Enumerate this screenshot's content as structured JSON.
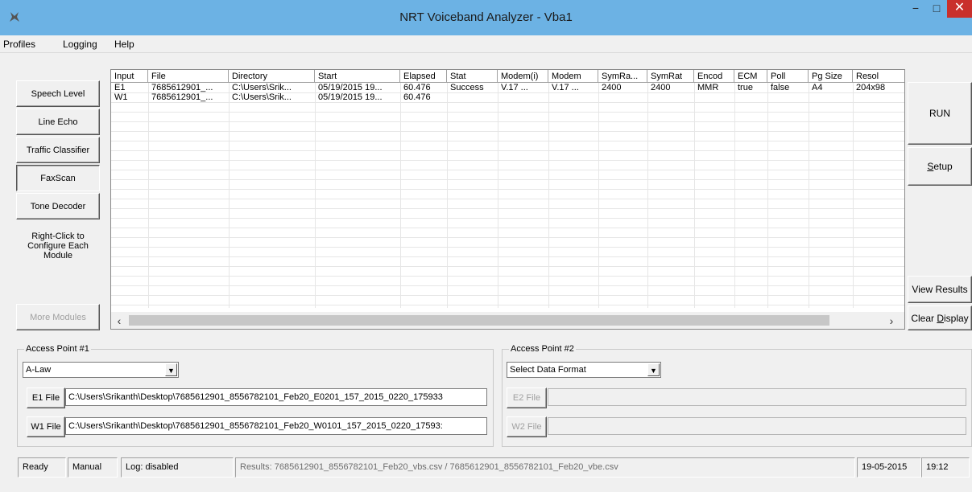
{
  "window": {
    "title": "NRT Voiceband Analyzer - Vba1",
    "minimize": "−",
    "maximize": "□",
    "close": "✕",
    "app_icon": "vba-app-icon"
  },
  "menu": [
    "Profiles",
    "Logging",
    "Help"
  ],
  "modules": [
    "Speech Level",
    "Line Echo",
    "Traffic Classifier",
    "FaxScan",
    "Tone Decoder"
  ],
  "module_note": [
    "Right-Click to",
    "Configure Each",
    "Module"
  ],
  "more_modules": "More Modules",
  "table": {
    "columns": [
      "Input",
      "File",
      "Directory",
      "Start",
      "Elapsed",
      "Stat",
      "Modem(i)",
      "Modem",
      "SymRa...",
      "SymRat",
      "Encod",
      "ECM",
      "Poll",
      "Pg Size",
      "Resol"
    ],
    "rows": [
      [
        "E1",
        "7685612901_...",
        "C:\\Users\\Srik...",
        "05/19/2015 19...",
        "60.476",
        "Success",
        "V.17 ...",
        "V.17 ...",
        "2400",
        "2400",
        "MMR",
        "true",
        "false",
        "A4",
        "204x98"
      ],
      [
        "W1",
        "7685612901_...",
        "C:\\Users\\Srik...",
        "05/19/2015 19...",
        "60.476",
        "",
        "",
        "",
        "",
        "",
        "",
        "",
        "",
        "",
        ""
      ]
    ]
  },
  "right_buttons": {
    "run": "RUN",
    "setup_prefix": "",
    "setup_mnemonic": "S",
    "setup_rest": "etup",
    "view_results": "View Results",
    "clear_prefix": "Clear ",
    "clear_mnemonic": "D",
    "clear_rest": "isplay"
  },
  "access_point_1": {
    "label": "Access Point #1",
    "format": "A-Law",
    "e1_button": "E1 File",
    "e1_path": "C:\\Users\\Srikanth\\Desktop\\7685612901_8556782101_Feb20_E0201_157_2015_0220_175933",
    "w1_button": "W1 File",
    "w1_path": "C:\\Users\\Srikanth\\Desktop\\7685612901_8556782101_Feb20_W0101_157_2015_0220_17593:"
  },
  "access_point_2": {
    "label": "Access Point #2",
    "format": "Select Data Format",
    "e2_button": "E2 File",
    "e2_path": "",
    "w2_button": "W2 File",
    "w2_path": ""
  },
  "status": {
    "ready": "Ready",
    "mode": "Manual",
    "log": "Log: disabled",
    "results": "Results: 7685612901_8556782101_Feb20_vbs.csv / 7685612901_8556782101_Feb20_vbe.csv",
    "date": "19-05-2015",
    "time": "19:12"
  }
}
